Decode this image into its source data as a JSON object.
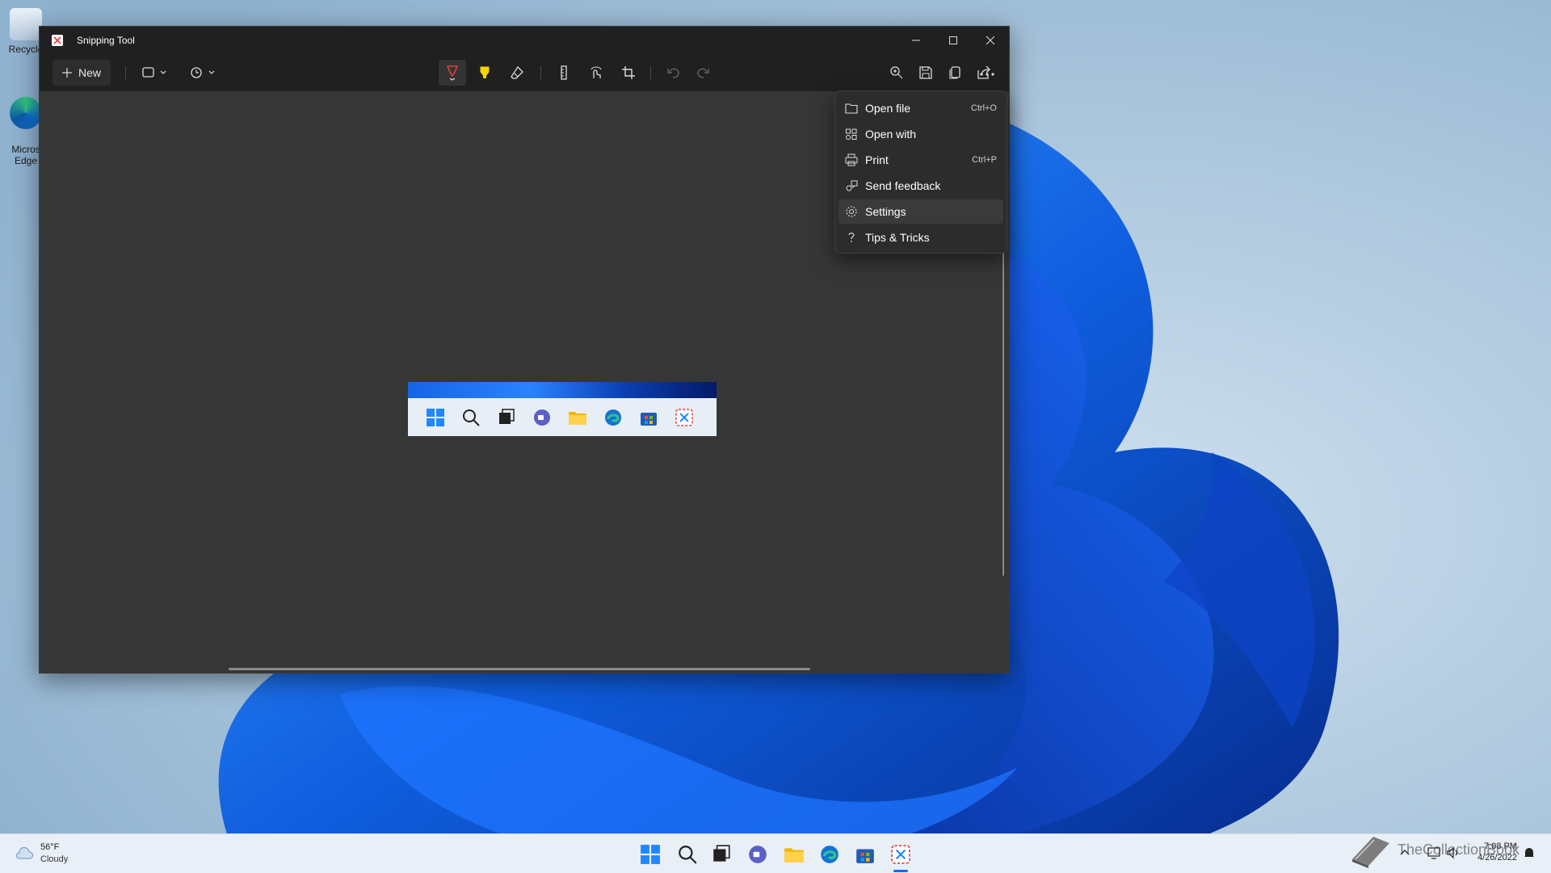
{
  "desktop": {
    "icons": [
      {
        "label": "Recycle"
      },
      {
        "label": "Micros\nEdge"
      }
    ]
  },
  "window": {
    "title": "Snipping Tool",
    "controls": {
      "minimize": "—",
      "maximize": "☐",
      "close": "✕"
    }
  },
  "toolbar": {
    "new_label": "New"
  },
  "menu": {
    "items": [
      {
        "label": "Open file",
        "shortcut": "Ctrl+O",
        "icon": "folder-icon"
      },
      {
        "label": "Open with",
        "shortcut": "",
        "icon": "open-with-icon"
      },
      {
        "label": "Print",
        "shortcut": "Ctrl+P",
        "icon": "printer-icon"
      },
      {
        "label": "Send feedback",
        "shortcut": "",
        "icon": "feedback-icon"
      },
      {
        "label": "Settings",
        "shortcut": "",
        "icon": "gear-icon"
      },
      {
        "label": "Tips & Tricks",
        "shortcut": "",
        "icon": "question-icon"
      }
    ]
  },
  "taskbar": {
    "weather": {
      "temp": "56°F",
      "condition": "Cloudy"
    },
    "clock": {
      "time": "7:08 PM",
      "date": "4/26/2022"
    }
  },
  "watermark": "TheCollectionBook",
  "colors": {
    "accent_blue": "#0f6cff",
    "window_bg": "#2b2b2b",
    "canvas_bg": "#363636",
    "pen_red": "#e04040",
    "highlighter_yellow": "#f5d400"
  }
}
